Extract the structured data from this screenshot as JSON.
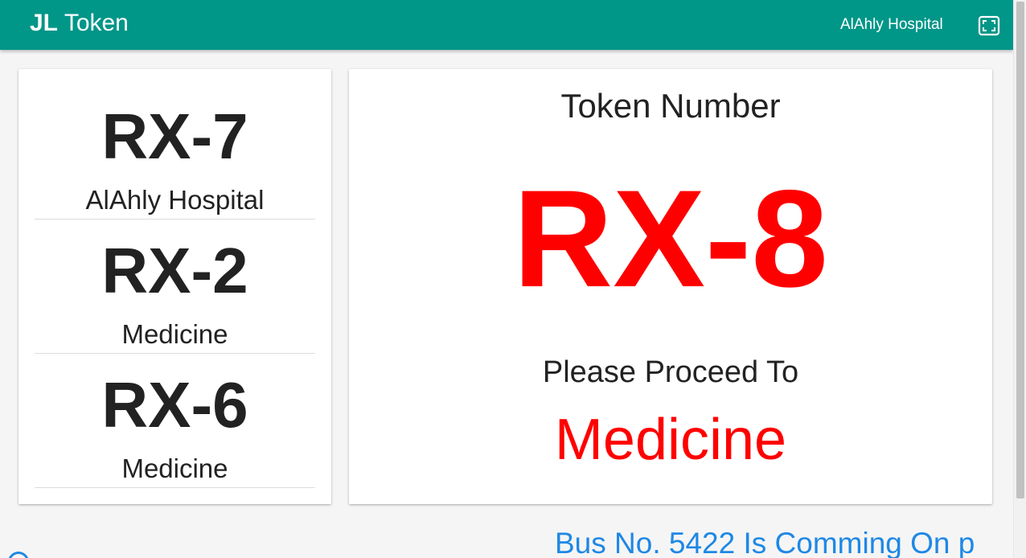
{
  "header": {
    "brand_bold": "JL",
    "brand_light": "Token",
    "hospital": "AlAhly Hospital",
    "fullscreen_icon": "fullscreen-icon",
    "bar_color": "#009688"
  },
  "queue": [
    {
      "token": "RX-7",
      "department": "AlAhly Hospital"
    },
    {
      "token": "RX-2",
      "department": "Medicine"
    },
    {
      "token": "RX-6",
      "department": "Medicine"
    }
  ],
  "current": {
    "title": "Token Number",
    "token": "RX-8",
    "proceed_text": "Please Proceed To",
    "destination": "Medicine",
    "highlight_color": "#ff0000"
  },
  "ticker": {
    "text": "Bus No. 5422 Is Comming On p",
    "color": "#1e88e5"
  }
}
